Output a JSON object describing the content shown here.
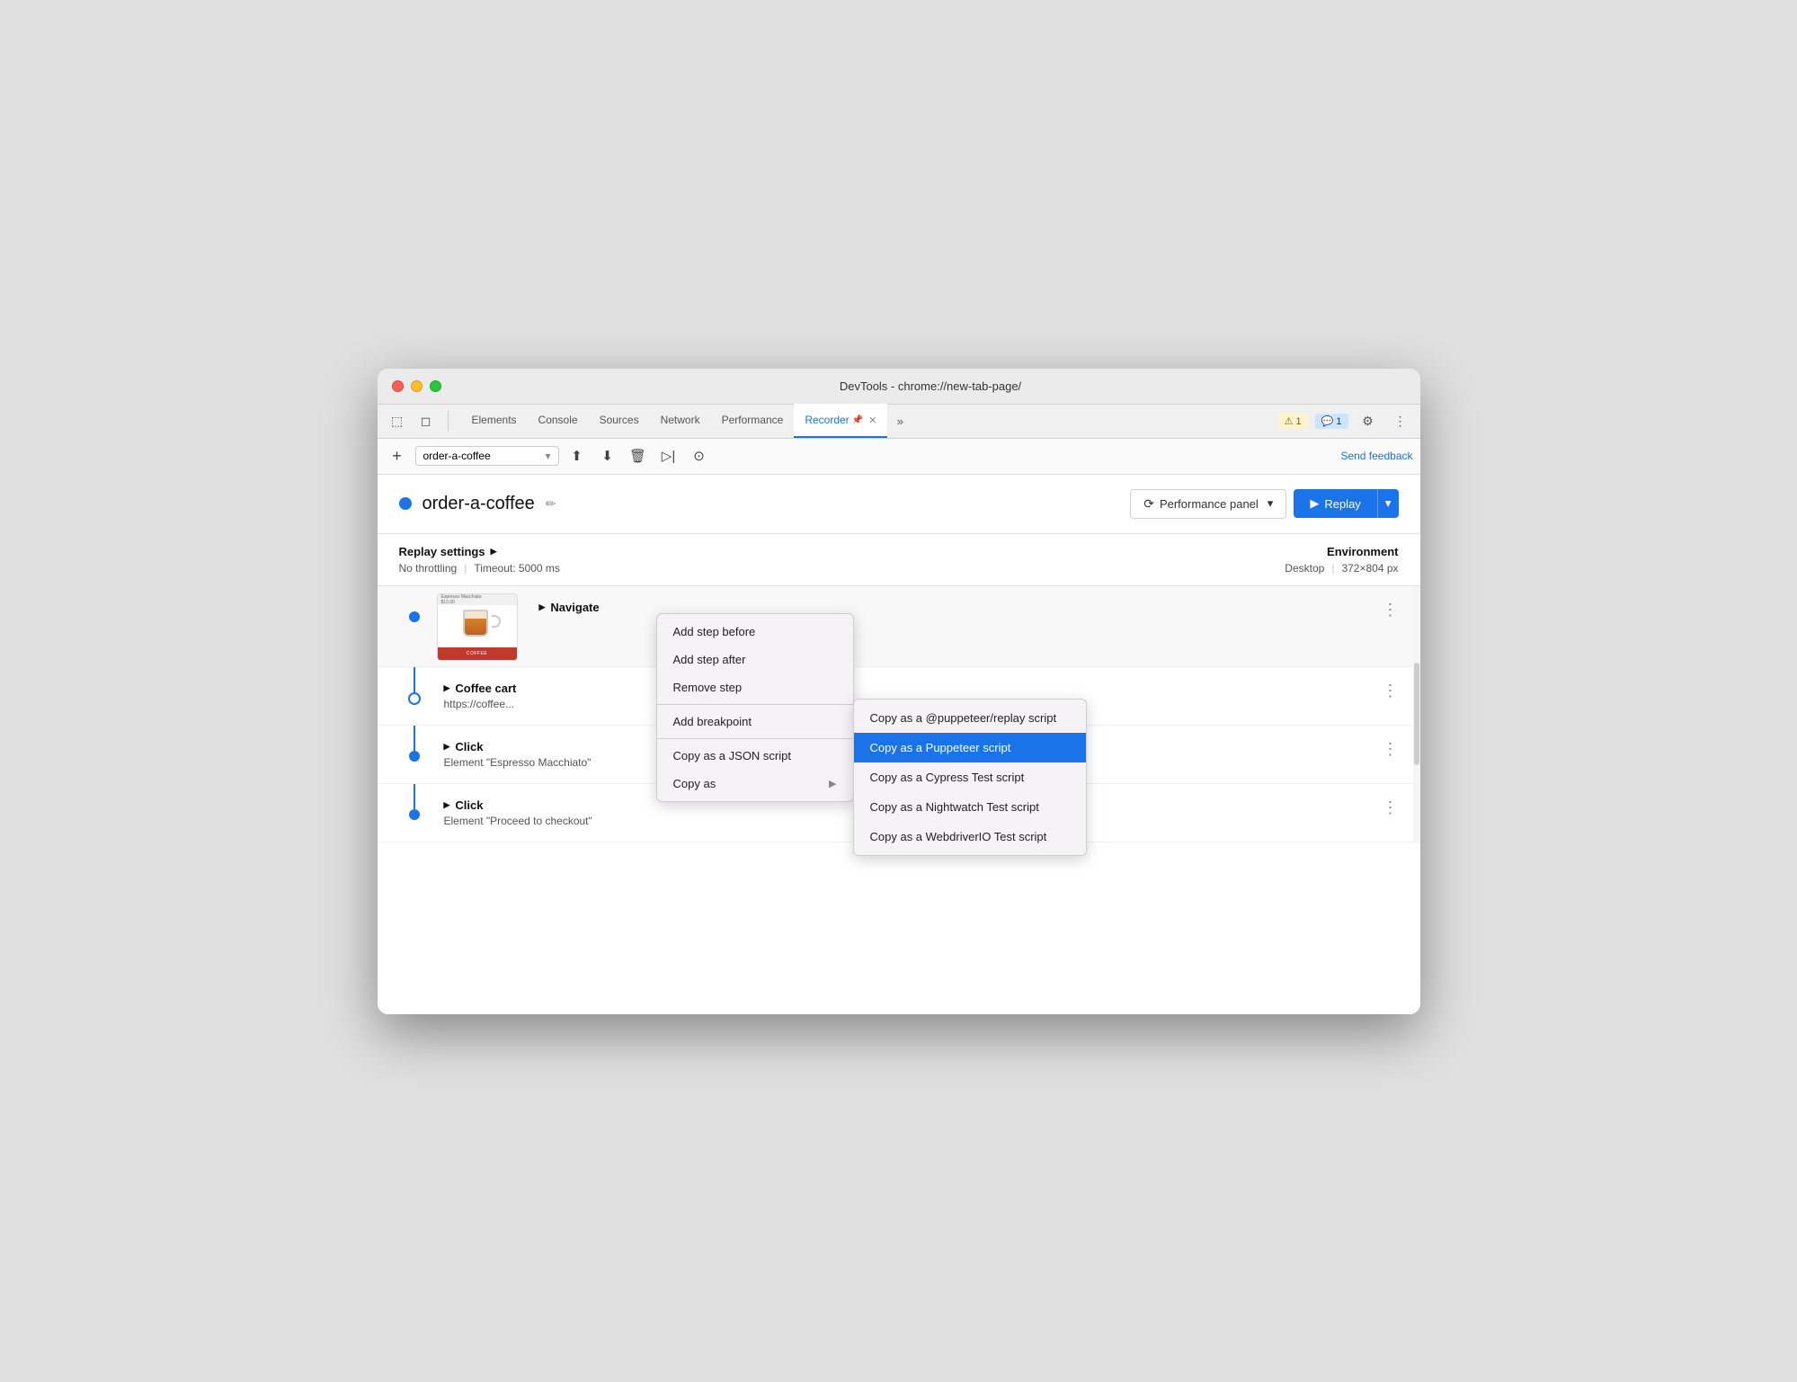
{
  "window": {
    "title": "DevTools - chrome://new-tab-page/"
  },
  "tabbar": {
    "tabs": [
      {
        "id": "elements",
        "label": "Elements"
      },
      {
        "id": "console",
        "label": "Console"
      },
      {
        "id": "sources",
        "label": "Sources"
      },
      {
        "id": "network",
        "label": "Network"
      },
      {
        "id": "performance",
        "label": "Performance"
      },
      {
        "id": "recorder",
        "label": "Recorder",
        "active": true,
        "pinned": true,
        "closable": true
      }
    ],
    "warn_badge": "⚠ 1",
    "info_badge": "💬 1"
  },
  "toolbar": {
    "add_btn": "+",
    "recording_name": "order-a-coffee",
    "send_feedback": "Send feedback"
  },
  "recording": {
    "name": "order-a-coffee",
    "perf_panel_label": "Performance panel",
    "replay_label": "Replay"
  },
  "settings": {
    "replay_settings_label": "Replay settings",
    "throttling": "No throttling",
    "timeout": "Timeout: 5000 ms",
    "environment_label": "Environment",
    "desktop": "Desktop",
    "resolution": "372×804 px"
  },
  "steps": [
    {
      "id": "navigate",
      "type": "Navigate",
      "sublabel": "",
      "has_screenshot": true
    },
    {
      "id": "coffee-cart",
      "type": "Coffee cart",
      "sublabel": "https://coffee...",
      "is_hollow": true
    },
    {
      "id": "click-espresso",
      "type": "Click",
      "sublabel": "Element \"Espresso Macchiato\""
    },
    {
      "id": "click-checkout",
      "type": "Click",
      "sublabel": "Element \"Proceed to checkout\""
    }
  ],
  "context_menu": {
    "items": [
      {
        "id": "add-step-before",
        "label": "Add step before"
      },
      {
        "id": "add-step-after",
        "label": "Add step after"
      },
      {
        "id": "remove-step",
        "label": "Remove step"
      },
      {
        "id": "add-breakpoint",
        "label": "Add breakpoint"
      },
      {
        "id": "copy-json",
        "label": "Copy as a JSON script"
      },
      {
        "id": "copy-as",
        "label": "Copy as",
        "has_submenu": true
      }
    ],
    "submenu": {
      "items": [
        {
          "id": "copy-puppeteer-replay",
          "label": "Copy as a @puppeteer/replay script"
        },
        {
          "id": "copy-puppeteer",
          "label": "Copy as a Puppeteer script",
          "active": true
        },
        {
          "id": "copy-cypress",
          "label": "Copy as a Cypress Test script"
        },
        {
          "id": "copy-nightwatch",
          "label": "Copy as a Nightwatch Test script"
        },
        {
          "id": "copy-webdriverio",
          "label": "Copy as a WebdriverIO Test script"
        }
      ]
    }
  }
}
